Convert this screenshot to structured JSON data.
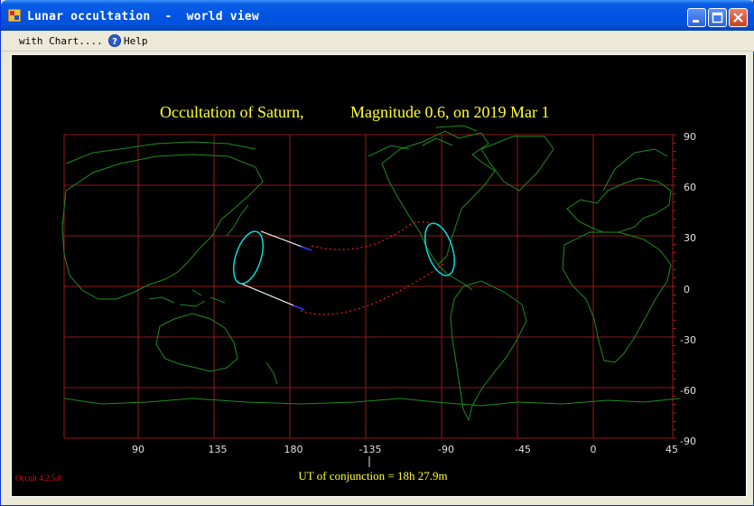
{
  "window": {
    "title": "Lunar occultation  -  world view"
  },
  "menu": {
    "items": [
      "with Chart....",
      "Help"
    ]
  },
  "chart": {
    "title_parts": [
      "Occultation  of  Saturn,",
      "Magnitude 0.6,   on  2019 Mar  1"
    ],
    "x_ticks": [
      "90",
      "135",
      "180",
      "-135",
      "-90",
      "-45",
      "0",
      "45"
    ],
    "y_ticks": [
      "90",
      "60",
      "30",
      "0",
      "-30",
      "-60",
      "-90"
    ],
    "footer": "UT of conjunction = 18h 27.9m",
    "version": "Occult 4.2.5.0",
    "colors": {
      "grid": "#C02020",
      "coastline": "#1E8C1E",
      "title": "#FFFF33",
      "axis_text": "#E0E0E0",
      "ellipse": "#00E0E0",
      "path_dotted": "#E02020",
      "limit_line": "#FFFFFF",
      "version_text": "#E01010"
    }
  },
  "chart_data": {
    "type": "map",
    "title": "Occultation of Saturn, Magnitude 0.6, on 2019 Mar 1",
    "x_tick_labels": [
      "90",
      "135",
      "180",
      "-135",
      "-90",
      "-45",
      "0",
      "45"
    ],
    "y_tick_labels": [
      "90",
      "60",
      "30",
      "0",
      "-30",
      "-60",
      "-90"
    ],
    "x_range_deg_longitude": [
      58,
      46
    ],
    "y_range_deg_latitude": [
      -90,
      90
    ],
    "grid": true,
    "annotations": [
      "UT of conjunction = 18h 27.9m",
      "Occult 4.2.5.0"
    ]
  }
}
